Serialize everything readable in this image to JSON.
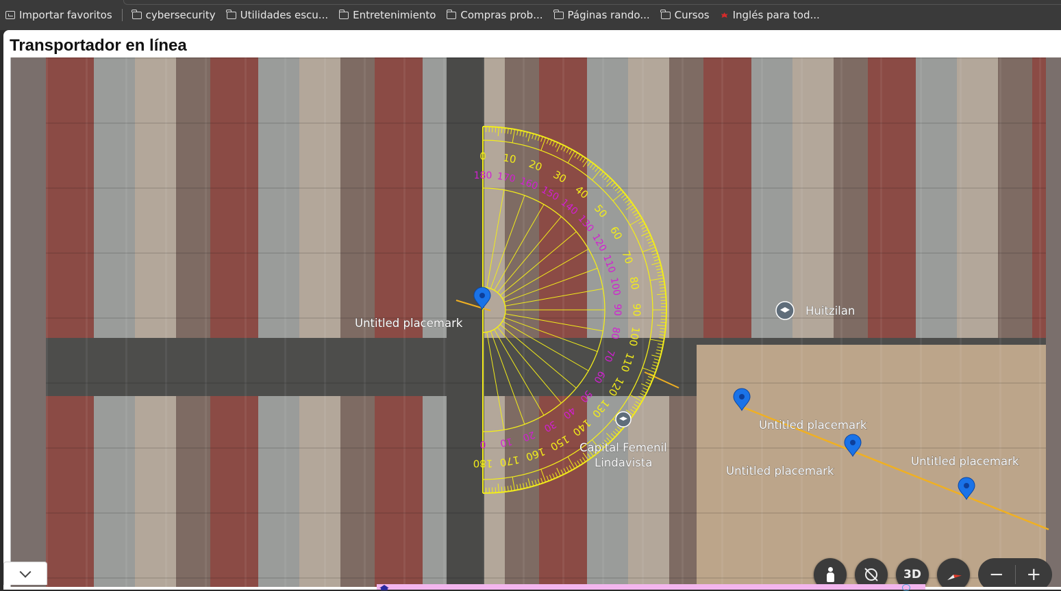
{
  "bookmarks": [
    {
      "label": "Importar favoritos",
      "icon": "import-icon"
    },
    {
      "label": "cybersecurity",
      "icon": "folder-icon"
    },
    {
      "label": "Utilidades escu...",
      "icon": "folder-icon"
    },
    {
      "label": "Entretenimiento",
      "icon": "folder-icon"
    },
    {
      "label": "Compras prob...",
      "icon": "folder-icon"
    },
    {
      "label": "Páginas rando...",
      "icon": "folder-icon"
    },
    {
      "label": "Cursos",
      "icon": "folder-icon"
    },
    {
      "label": "Inglés para tod...",
      "icon": "canada-flag-icon"
    }
  ],
  "page": {
    "title": "Transportador en línea"
  },
  "map": {
    "labels": {
      "placemark_1": "Untitled placemark",
      "placemark_2": "Untitled placemark",
      "placemark_3": "Untitled placemark",
      "placemark_4": "Untitled placemark",
      "huitzilan": "Huitzilan",
      "capital_femenil_line1": "Capital Femenil",
      "capital_femenil_line2": "Lindavista"
    },
    "colors": {
      "placemark_pin": "#1a73e8",
      "protractor": "#f2ec1a",
      "protractor_inner_scale": "#d21fd2",
      "measure_line": "#f0b022"
    }
  },
  "protractor": {
    "outer_scale": [
      "0",
      "10",
      "20",
      "30",
      "40",
      "50",
      "60",
      "70",
      "80",
      "90",
      "100",
      "110",
      "120",
      "130",
      "140",
      "150",
      "160",
      "170",
      "180"
    ],
    "inner_scale": [
      "180",
      "170",
      "160",
      "150",
      "140",
      "130",
      "120",
      "110",
      "100",
      "90",
      "80",
      "70",
      "60",
      "50",
      "40",
      "30",
      "20",
      "10",
      "0"
    ]
  },
  "controls": {
    "street_view": "street-view-icon",
    "reset_rotation": "no-rotate-icon",
    "view_3d": "3D",
    "compass": "compass-icon",
    "zoom_out": "−",
    "zoom_in": "+"
  }
}
